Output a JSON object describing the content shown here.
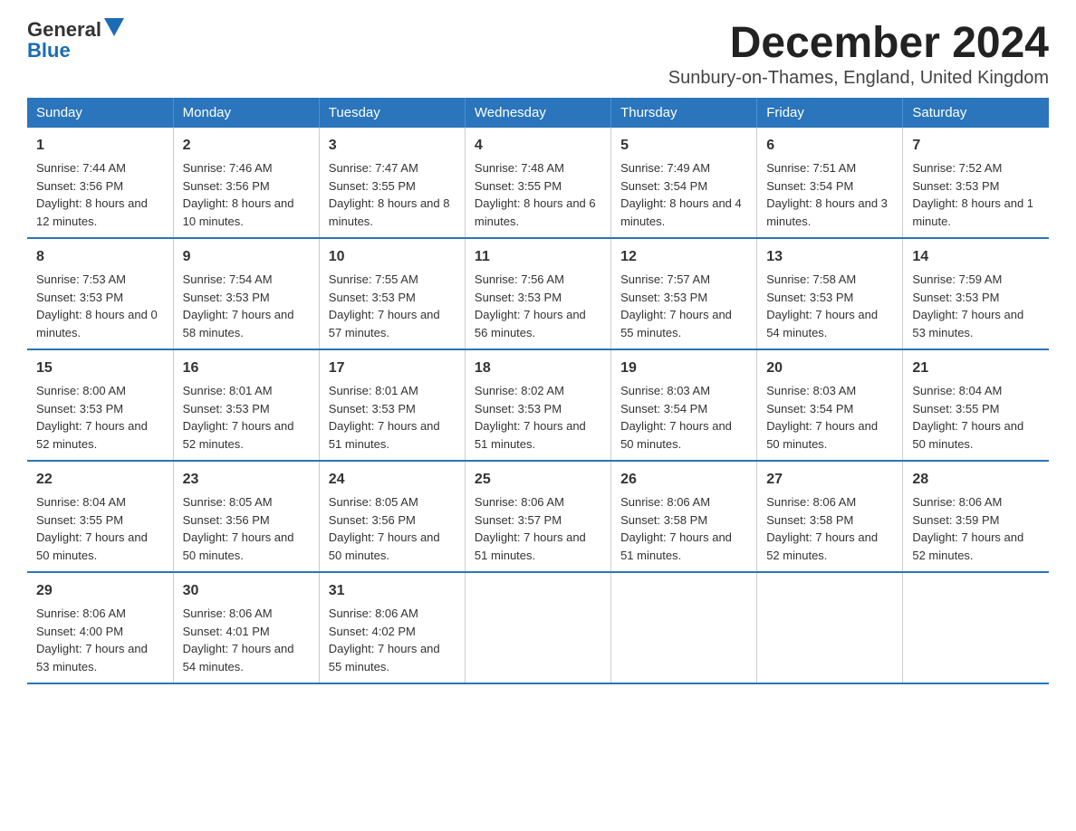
{
  "logo": {
    "general": "General",
    "blue": "Blue"
  },
  "title": "December 2024",
  "location": "Sunbury-on-Thames, England, United Kingdom",
  "headers": [
    "Sunday",
    "Monday",
    "Tuesday",
    "Wednesday",
    "Thursday",
    "Friday",
    "Saturday"
  ],
  "weeks": [
    [
      {
        "day": "1",
        "sunrise": "7:44 AM",
        "sunset": "3:56 PM",
        "daylight": "8 hours and 12 minutes."
      },
      {
        "day": "2",
        "sunrise": "7:46 AM",
        "sunset": "3:56 PM",
        "daylight": "8 hours and 10 minutes."
      },
      {
        "day": "3",
        "sunrise": "7:47 AM",
        "sunset": "3:55 PM",
        "daylight": "8 hours and 8 minutes."
      },
      {
        "day": "4",
        "sunrise": "7:48 AM",
        "sunset": "3:55 PM",
        "daylight": "8 hours and 6 minutes."
      },
      {
        "day": "5",
        "sunrise": "7:49 AM",
        "sunset": "3:54 PM",
        "daylight": "8 hours and 4 minutes."
      },
      {
        "day": "6",
        "sunrise": "7:51 AM",
        "sunset": "3:54 PM",
        "daylight": "8 hours and 3 minutes."
      },
      {
        "day": "7",
        "sunrise": "7:52 AM",
        "sunset": "3:53 PM",
        "daylight": "8 hours and 1 minute."
      }
    ],
    [
      {
        "day": "8",
        "sunrise": "7:53 AM",
        "sunset": "3:53 PM",
        "daylight": "8 hours and 0 minutes."
      },
      {
        "day": "9",
        "sunrise": "7:54 AM",
        "sunset": "3:53 PM",
        "daylight": "7 hours and 58 minutes."
      },
      {
        "day": "10",
        "sunrise": "7:55 AM",
        "sunset": "3:53 PM",
        "daylight": "7 hours and 57 minutes."
      },
      {
        "day": "11",
        "sunrise": "7:56 AM",
        "sunset": "3:53 PM",
        "daylight": "7 hours and 56 minutes."
      },
      {
        "day": "12",
        "sunrise": "7:57 AM",
        "sunset": "3:53 PM",
        "daylight": "7 hours and 55 minutes."
      },
      {
        "day": "13",
        "sunrise": "7:58 AM",
        "sunset": "3:53 PM",
        "daylight": "7 hours and 54 minutes."
      },
      {
        "day": "14",
        "sunrise": "7:59 AM",
        "sunset": "3:53 PM",
        "daylight": "7 hours and 53 minutes."
      }
    ],
    [
      {
        "day": "15",
        "sunrise": "8:00 AM",
        "sunset": "3:53 PM",
        "daylight": "7 hours and 52 minutes."
      },
      {
        "day": "16",
        "sunrise": "8:01 AM",
        "sunset": "3:53 PM",
        "daylight": "7 hours and 52 minutes."
      },
      {
        "day": "17",
        "sunrise": "8:01 AM",
        "sunset": "3:53 PM",
        "daylight": "7 hours and 51 minutes."
      },
      {
        "day": "18",
        "sunrise": "8:02 AM",
        "sunset": "3:53 PM",
        "daylight": "7 hours and 51 minutes."
      },
      {
        "day": "19",
        "sunrise": "8:03 AM",
        "sunset": "3:54 PM",
        "daylight": "7 hours and 50 minutes."
      },
      {
        "day": "20",
        "sunrise": "8:03 AM",
        "sunset": "3:54 PM",
        "daylight": "7 hours and 50 minutes."
      },
      {
        "day": "21",
        "sunrise": "8:04 AM",
        "sunset": "3:55 PM",
        "daylight": "7 hours and 50 minutes."
      }
    ],
    [
      {
        "day": "22",
        "sunrise": "8:04 AM",
        "sunset": "3:55 PM",
        "daylight": "7 hours and 50 minutes."
      },
      {
        "day": "23",
        "sunrise": "8:05 AM",
        "sunset": "3:56 PM",
        "daylight": "7 hours and 50 minutes."
      },
      {
        "day": "24",
        "sunrise": "8:05 AM",
        "sunset": "3:56 PM",
        "daylight": "7 hours and 50 minutes."
      },
      {
        "day": "25",
        "sunrise": "8:06 AM",
        "sunset": "3:57 PM",
        "daylight": "7 hours and 51 minutes."
      },
      {
        "day": "26",
        "sunrise": "8:06 AM",
        "sunset": "3:58 PM",
        "daylight": "7 hours and 51 minutes."
      },
      {
        "day": "27",
        "sunrise": "8:06 AM",
        "sunset": "3:58 PM",
        "daylight": "7 hours and 52 minutes."
      },
      {
        "day": "28",
        "sunrise": "8:06 AM",
        "sunset": "3:59 PM",
        "daylight": "7 hours and 52 minutes."
      }
    ],
    [
      {
        "day": "29",
        "sunrise": "8:06 AM",
        "sunset": "4:00 PM",
        "daylight": "7 hours and 53 minutes."
      },
      {
        "day": "30",
        "sunrise": "8:06 AM",
        "sunset": "4:01 PM",
        "daylight": "7 hours and 54 minutes."
      },
      {
        "day": "31",
        "sunrise": "8:06 AM",
        "sunset": "4:02 PM",
        "daylight": "7 hours and 55 minutes."
      },
      null,
      null,
      null,
      null
    ]
  ]
}
